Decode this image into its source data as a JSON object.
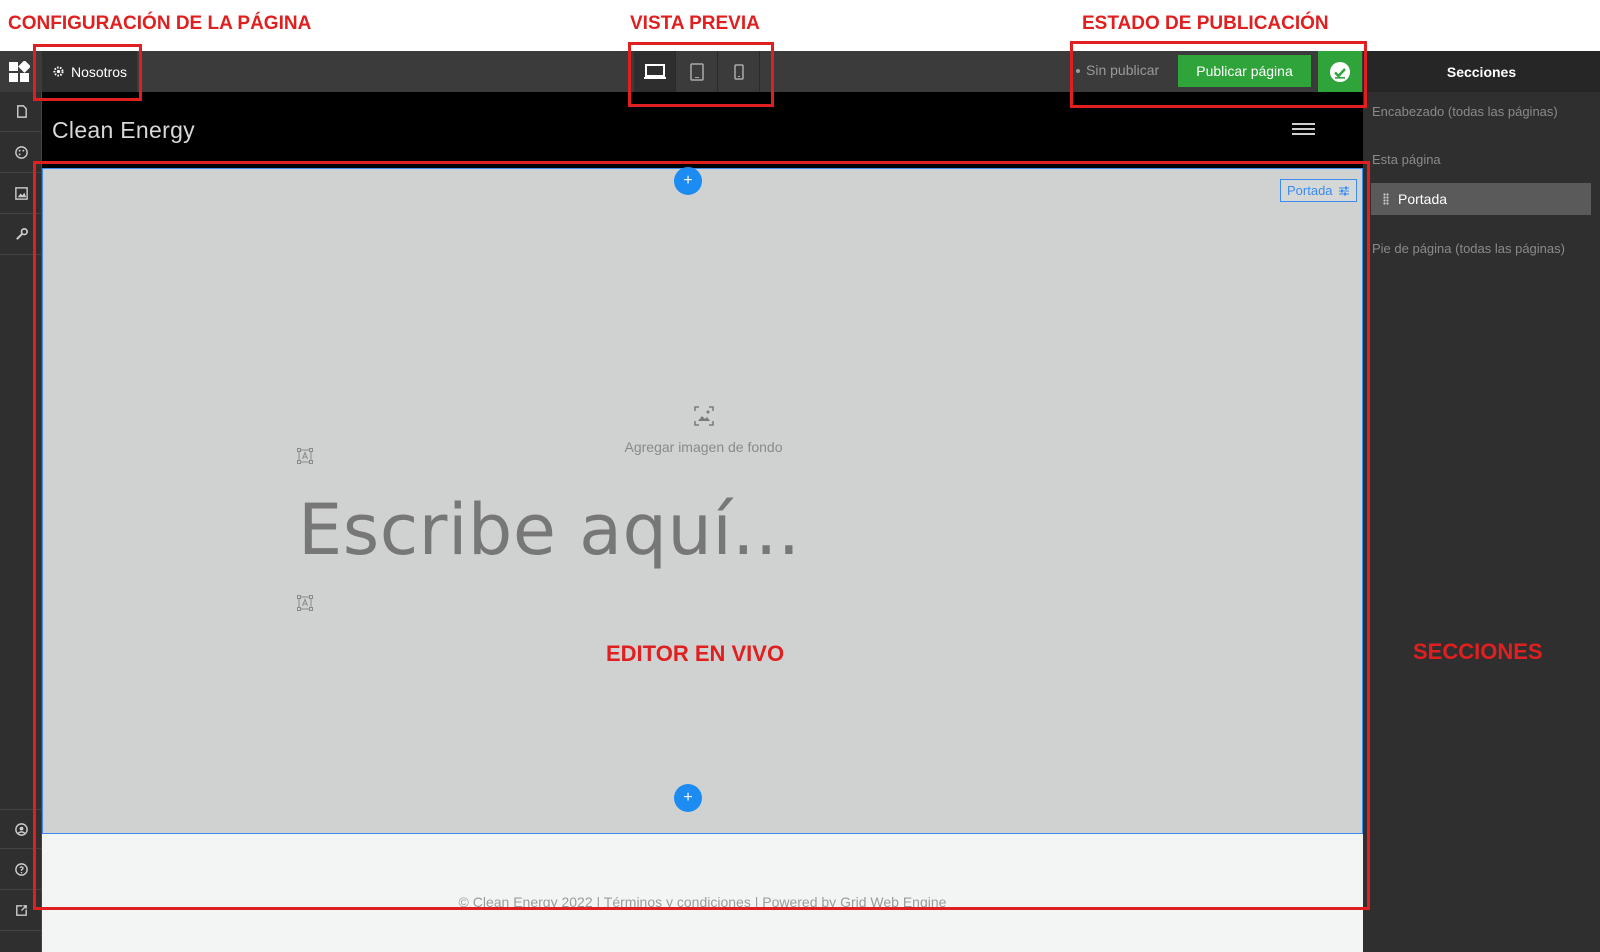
{
  "annotations": {
    "page_config": "CONFIGURACIÓN DE LA PÁGINA",
    "preview": "VISTA PREVIA",
    "publish_state": "ESTADO DE PUBLICACIÓN",
    "live_editor": "EDITOR EN VIVO",
    "sections": "SECCIONES"
  },
  "toolbar": {
    "page_name": "Nosotros",
    "status": "Sin publicar",
    "publish_label": "Publicar página",
    "preview_modes": [
      "desktop-icon",
      "tablet-icon",
      "mobile-icon"
    ],
    "accent_color": "#2ea43a"
  },
  "rail": {
    "top_icons": [
      "pages-icon",
      "palette-icon",
      "image-icon",
      "wrench-icon"
    ],
    "bottom_icons": [
      "account-icon",
      "help-icon",
      "external-link-icon"
    ]
  },
  "panel": {
    "title": "Secciones",
    "header_label": "Encabezado (todas las páginas)",
    "this_page_label": "Esta página",
    "items": [
      {
        "label": "Portada"
      }
    ],
    "footer_label": "Pie de página (todas las páginas)"
  },
  "canvas": {
    "site_logo": "Clean Energy",
    "section_tag": "Portada",
    "bg_prompt": "Agregar imagen de fondo",
    "heading": "Escribe aquí...",
    "footer": "© Clean Energy 2022 | Términos y condiciones | Powered by Grid Web Engine",
    "selection_color": "#3a8cf0"
  }
}
